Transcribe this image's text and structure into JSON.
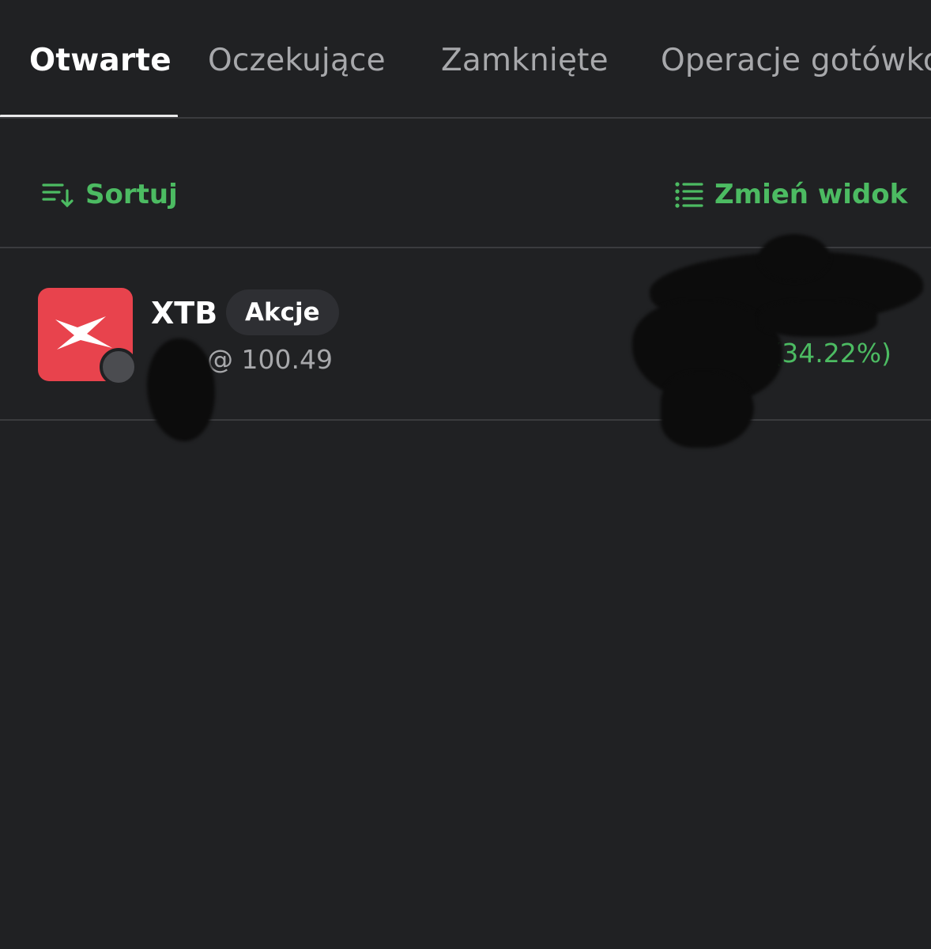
{
  "tabs": [
    {
      "label": "Otwarte",
      "active": true
    },
    {
      "label": "Oczekujące",
      "active": false
    },
    {
      "label": "Zamknięte",
      "active": false
    },
    {
      "label": "Operacje gotówkowe",
      "active": false
    }
  ],
  "toolbar": {
    "sort_label": "Sortuj",
    "sort_icon": "sort-icon",
    "view_label": "Zmień widok",
    "view_icon": "list-icon"
  },
  "position": {
    "symbol": "XTB",
    "type_badge": "Akcje",
    "open_price": "@ 100.49",
    "profit_percent": "(34.22%)",
    "logo_icon": "xtb-logo-icon",
    "logo_color": "#e8434d"
  },
  "colors": {
    "background": "#202123",
    "accent_green": "#4cbb62",
    "text_secondary": "#a7a8ab",
    "divider": "#3a3b3e"
  }
}
